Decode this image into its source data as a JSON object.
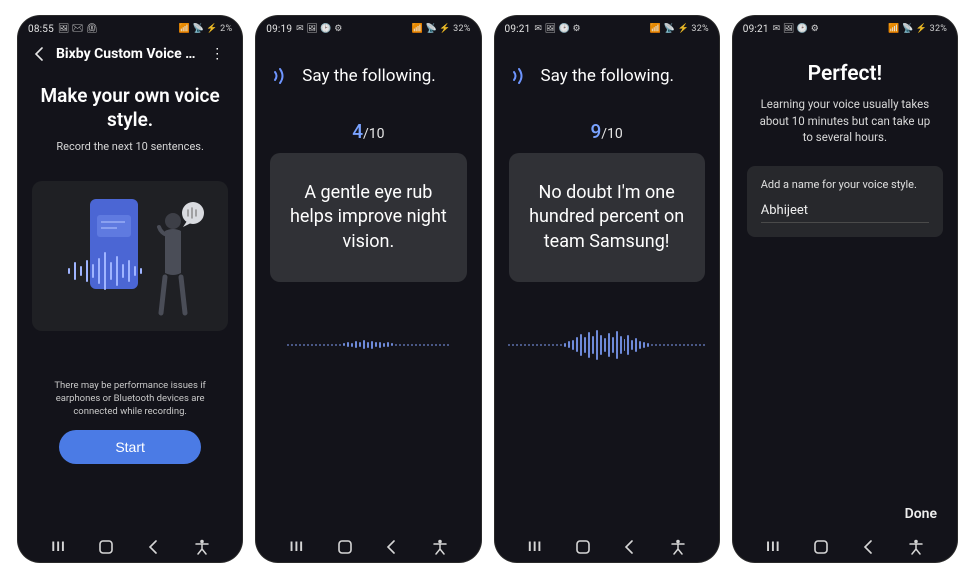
{
  "screens": [
    {
      "status": {
        "time": "08:55",
        "left_icons": "🖼 ✉ ⏲",
        "right_icons": "📶 📡 ⚡ 2%",
        "battery": "2%"
      },
      "header": {
        "title": "Bixby Custom Voice C…"
      },
      "title": "Make your own voice style.",
      "subtitle": "Record the next 10 sentences.",
      "note": "There may be performance issues if earphones or Bluetooth devices are connected while recording.",
      "start_label": "Start"
    },
    {
      "status": {
        "time": "09:19",
        "left_icons": "✉ 🖼 🕑 ⚙",
        "right_icons": "📶 📡 ⚡ 32%",
        "battery": "32%"
      },
      "title": "Say the following.",
      "counter_current": "4",
      "counter_total": "/10",
      "sentence": "A gentle eye rub helps improve night vision."
    },
    {
      "status": {
        "time": "09:21",
        "left_icons": "✉ 🖼 🕑 ⚙",
        "right_icons": "📶 📡 ⚡ 32%",
        "battery": "32%"
      },
      "title": "Say the following.",
      "counter_current": "9",
      "counter_total": "/10",
      "sentence": "No doubt I'm one hundred percent on team Samsung!"
    },
    {
      "status": {
        "time": "09:21",
        "left_icons": "✉ 🖼 🕑 ⚙",
        "right_icons": "📶 📡 ⚡ 32%",
        "battery": "32%"
      },
      "title": "Perfect!",
      "subtitle": "Learning your voice usually takes about 10 minutes but can take up to several hours.",
      "name_label": "Add a name for your voice style.",
      "name_value": "Abhijeet",
      "done_label": "Done"
    }
  ],
  "colors": {
    "accent": "#4b7be5",
    "background": "#13131a",
    "card": "#303136"
  }
}
